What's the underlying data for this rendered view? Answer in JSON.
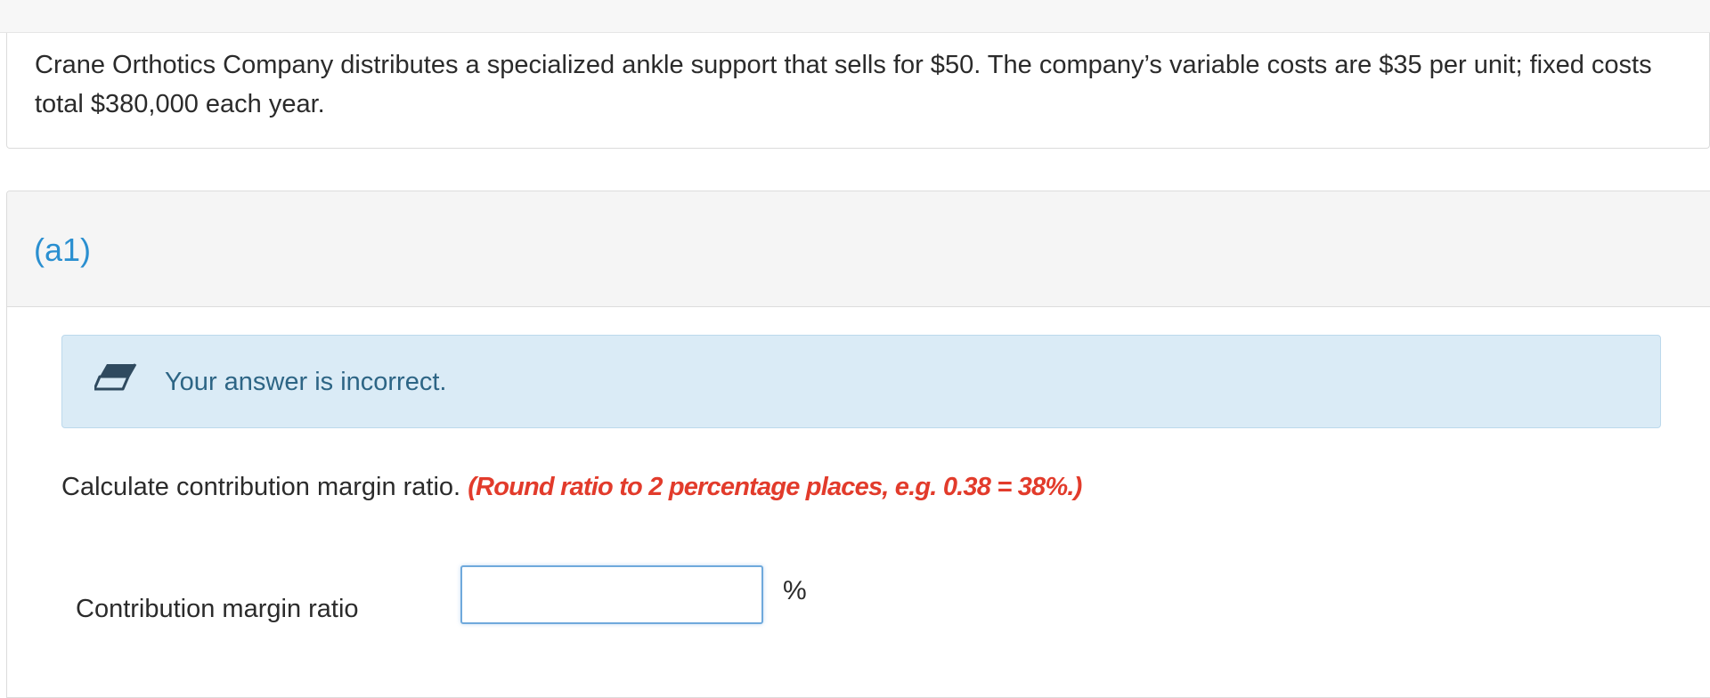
{
  "problem": {
    "text": "Crane Orthotics Company distributes a specialized ankle support that sells for $50. The company’s variable costs are $35 per unit; fixed costs total $380,000 each year."
  },
  "part": {
    "title": "(a1)",
    "feedback": {
      "icon": "eraser-icon",
      "message": "Your answer is incorrect.",
      "colors": {
        "background": "#daebf6",
        "text": "#2d6585"
      }
    },
    "question": {
      "prompt": "Calculate contribution margin ratio.",
      "hint": "(Round ratio to 2 percentage places, e.g. 0.38 = 38%.)",
      "hint_color": "#e23b2b"
    },
    "field": {
      "label": "Contribution margin ratio",
      "value": "",
      "unit": "%"
    }
  },
  "colors": {
    "accent": "#2a8fd0"
  }
}
